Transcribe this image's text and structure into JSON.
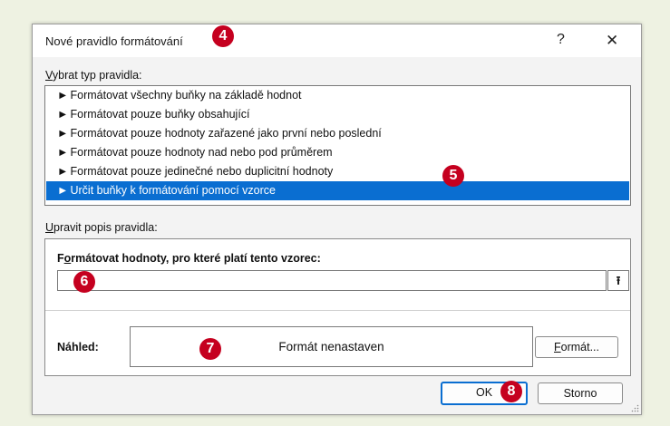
{
  "dialog": {
    "title": "Nové pravidlo formátování",
    "help_label": "?",
    "close_label": "✕"
  },
  "rule_type": {
    "section_label_first": "V",
    "section_label_rest": "ybrat typ pravidla:",
    "items": [
      {
        "label": "Formátovat všechny buňky na základě hodnot"
      },
      {
        "label": "Formátovat pouze buňky obsahující"
      },
      {
        "label": "Formátovat pouze hodnoty zařazené jako první nebo poslední"
      },
      {
        "label": "Formátovat pouze hodnoty nad nebo pod průměrem"
      },
      {
        "label": "Formátovat pouze jedinečné nebo duplicitní hodnoty"
      },
      {
        "label": "Určit buňky k formátování pomocí vzorce",
        "selected": true
      }
    ],
    "item_arrow": "►"
  },
  "rule_description": {
    "section_label_first": "U",
    "section_label_rest": "pravit popis pravidla:",
    "formula_label_first": "F",
    "formula_label_hot": "o",
    "formula_label_rest": "rmátovat hodnoty, pro které platí tento vzorec:",
    "formula_value": "",
    "collapse_icon_glyph": "⭱",
    "preview_label": "Náhled:",
    "preview_text": "Formát nenastaven",
    "format_button_hot": "F",
    "format_button_rest": "ormát..."
  },
  "buttons": {
    "ok_label": "OK",
    "cancel_label": "Storno"
  },
  "badges": {
    "b4": "4",
    "b5": "5",
    "b6": "6",
    "b7": "7",
    "b8": "8"
  },
  "colors": {
    "selection": "#0a6ed1",
    "badge": "#c5001f",
    "page_background": "#eef2e2"
  }
}
